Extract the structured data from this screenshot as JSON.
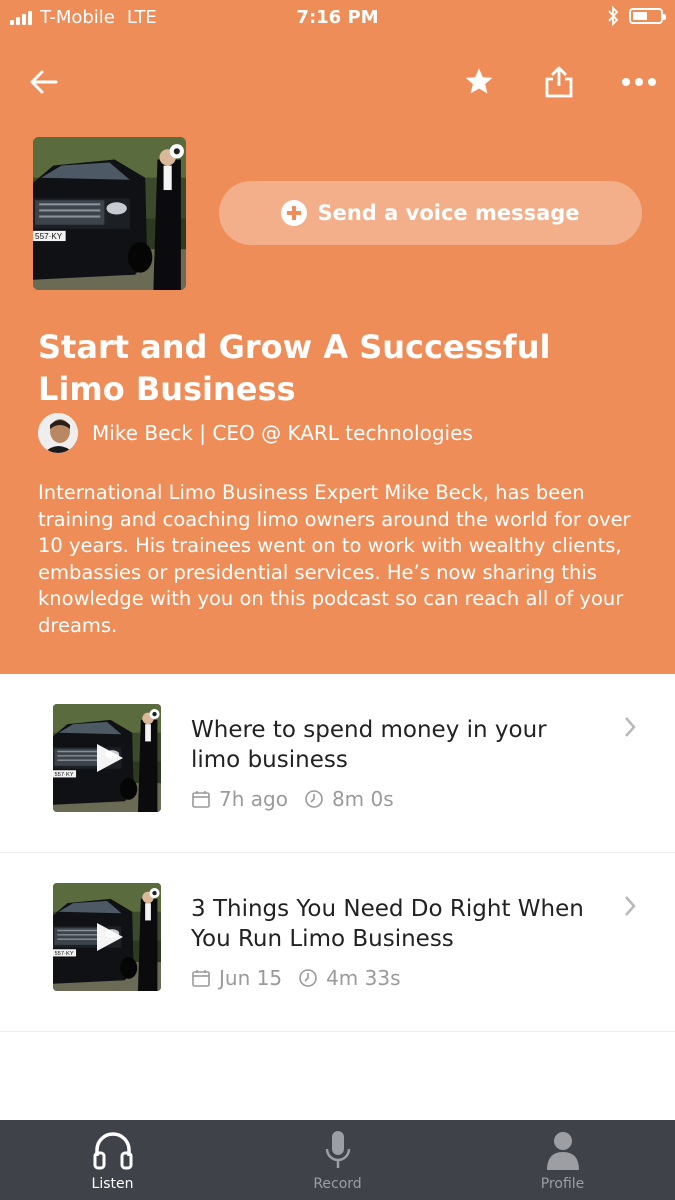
{
  "status_bar": {
    "carrier": "T-Mobile",
    "network": "LTE",
    "time": "7:16 PM",
    "battery_level": 0.55
  },
  "nav": {
    "back_icon": "arrow-left-icon",
    "favorite_icon": "star-icon",
    "share_icon": "share-icon",
    "more_icon": "more-dots-icon"
  },
  "podcast": {
    "voice_message_label": "Send a voice message",
    "title": "Start and Grow A Successful Limo Business",
    "author": "Mike Beck | CEO @ KARL technologies",
    "description": "International Limo Business Expert Mike Beck, has been training and coaching limo owners around the world for over 10 years. His trainees went on to work with wealthy clients, embassies or presidential services. He’s now sharing this knowledge with you on this podcast so can reach all of your dreams.",
    "cover_plate_text": "557-KY"
  },
  "episodes": [
    {
      "title": "Where to spend money in your limo business",
      "date": "7h ago",
      "duration": "8m 0s"
    },
    {
      "title": "3 Things You Need Do Right When You Run Limo Business",
      "date": "Jun 15",
      "duration": "4m 33s"
    }
  ],
  "tabs": [
    {
      "label": "Listen",
      "icon": "headphones-icon",
      "active": true
    },
    {
      "label": "Record",
      "icon": "microphone-icon",
      "active": false
    },
    {
      "label": "Profile",
      "icon": "person-icon",
      "active": false
    }
  ],
  "colors": {
    "brand": "#EE8D58",
    "tabbar": "#3F4249"
  }
}
